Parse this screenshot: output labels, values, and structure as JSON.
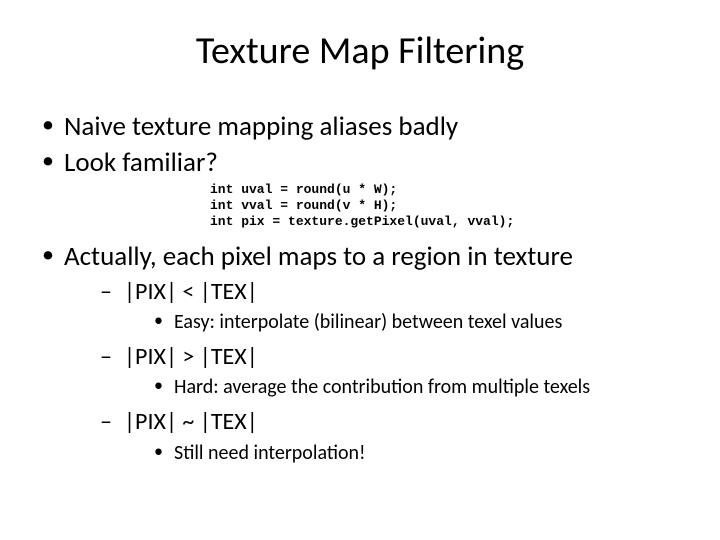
{
  "title": "Texture Map Filtering",
  "bullets": {
    "b1": "Naive texture mapping aliases badly",
    "b2": "Look familiar?",
    "code": "int uval = round(u * W);\nint vval = round(v * H);\nint pix = texture.getPixel(uval, vval);",
    "b3": "Actually, each pixel maps to a region in texture",
    "sub": {
      "s1": "|PIX| < |TEX|",
      "s1a": "Easy: interpolate (bilinear) between texel values",
      "s2": "|PIX| > |TEX|",
      "s2a": "Hard: average the contribution from multiple texels",
      "s3": "|PIX| ~ |TEX|",
      "s3a": "Still need interpolation!"
    }
  }
}
